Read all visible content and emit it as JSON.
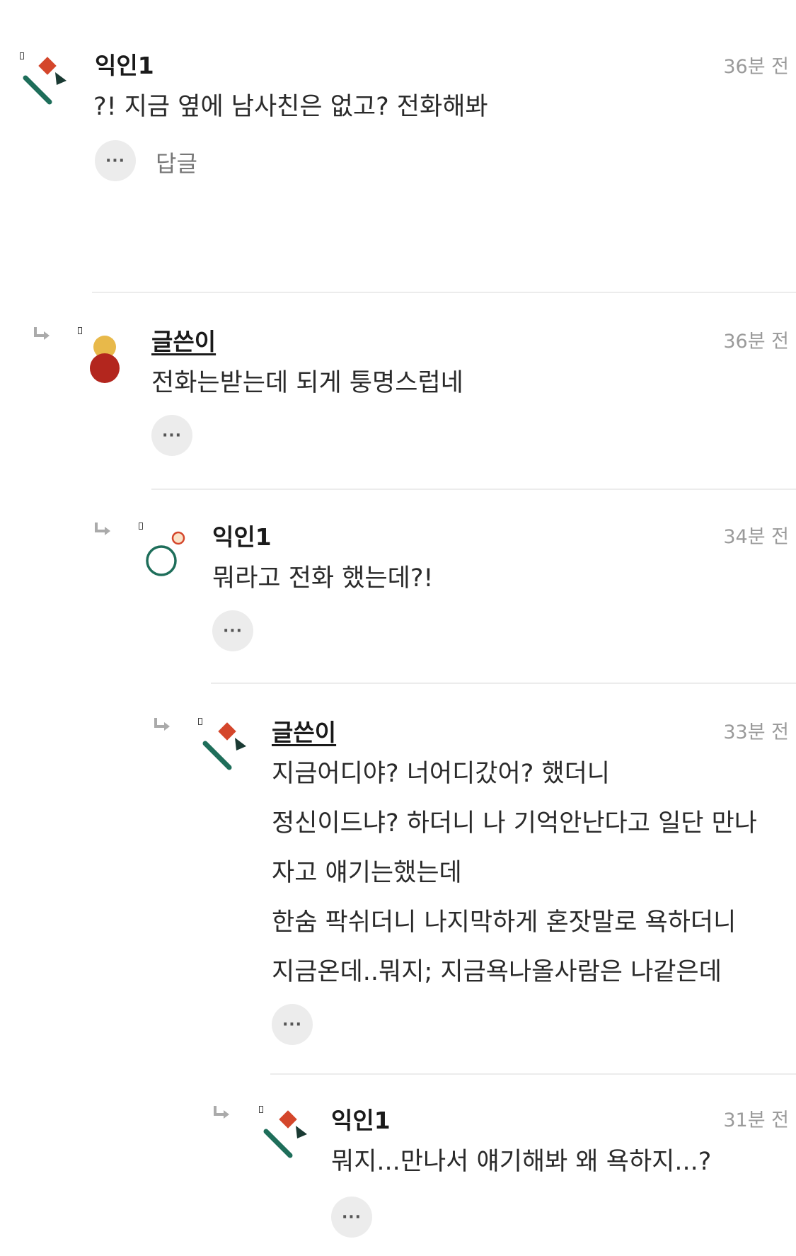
{
  "comments": [
    {
      "author": "익인1",
      "time": "36분 전",
      "lines": [
        "?! 지금 옆에 남사친은 없고? 전화해봐"
      ],
      "more_label": "···",
      "reply_label": "답글"
    },
    {
      "author": "글쓴이",
      "time": "36분 전",
      "lines": [
        "전화는받는데 되게 퉁명스럽네"
      ],
      "more_label": "···"
    },
    {
      "author": "익인1",
      "time": "34분 전",
      "lines": [
        "뭐라고 전화 했는데?!"
      ],
      "more_label": "···"
    },
    {
      "author": "글쓴이",
      "time": "33분 전",
      "lines": [
        "지금어디야? 너어디갔어? 했더니",
        "정신이드냐? 하더니 나 기억안난다고 일단 만나",
        "자고 얘기는했는데",
        "한숨 팍쉬더니 나지막하게 혼잣말로 욕하더니",
        "지금온데..뭐지; 지금욕나올사람은 나같은데"
      ],
      "more_label": "···"
    },
    {
      "author": "익인1",
      "time": "31분 전",
      "lines": [
        "뭐지...만나서 얘기해봐 왜 욕하지...?"
      ],
      "more_label": "···"
    }
  ],
  "colors": {
    "accent_red": "#d4462b",
    "accent_green": "#1e6e5a",
    "accent_yellow": "#e8b94a",
    "accent_darkred": "#b3261e",
    "muted": "#9a9a9a"
  }
}
